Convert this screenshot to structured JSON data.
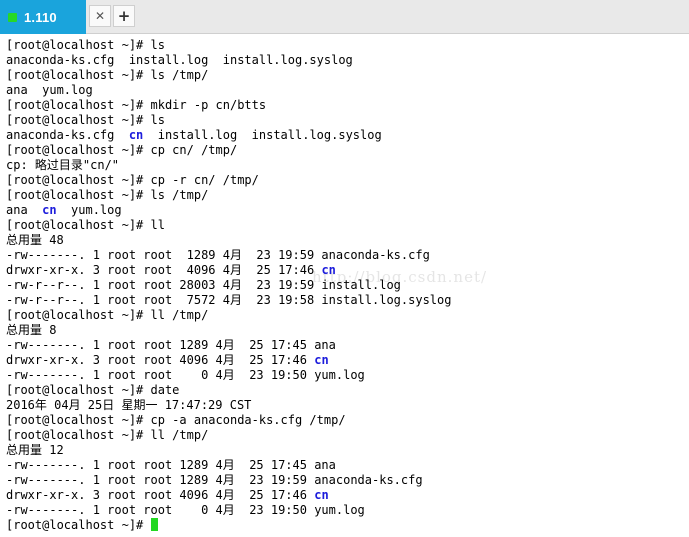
{
  "tab": {
    "label": "1.110",
    "close_glyph": "✕",
    "new_glyph": "+"
  },
  "watermark": "http://blog.csdn.net/",
  "terminal": {
    "lines": [
      [
        {
          "t": "[root@localhost ~]# ls"
        }
      ],
      [
        {
          "t": "anaconda-ks.cfg  install.log  install.log.syslog"
        }
      ],
      [
        {
          "t": "[root@localhost ~]# ls /tmp/"
        }
      ],
      [
        {
          "t": "ana  yum.log"
        }
      ],
      [
        {
          "t": "[root@localhost ~]# mkdir -p cn/btts"
        }
      ],
      [
        {
          "t": "[root@localhost ~]# ls"
        }
      ],
      [
        {
          "t": "anaconda-ks.cfg  "
        },
        {
          "t": "cn",
          "dir": true
        },
        {
          "t": "  install.log  install.log.syslog"
        }
      ],
      [
        {
          "t": "[root@localhost ~]# cp cn/ /tmp/"
        }
      ],
      [
        {
          "t": "cp: 略过目录\"cn/\""
        }
      ],
      [
        {
          "t": "[root@localhost ~]# cp -r cn/ /tmp/"
        }
      ],
      [
        {
          "t": "[root@localhost ~]# ls /tmp/"
        }
      ],
      [
        {
          "t": "ana  "
        },
        {
          "t": "cn",
          "dir": true
        },
        {
          "t": "  yum.log"
        }
      ],
      [
        {
          "t": "[root@localhost ~]# ll"
        }
      ],
      [
        {
          "t": "总用量 48"
        }
      ],
      [
        {
          "t": "-rw-------. 1 root root  1289 4月  23 19:59 anaconda-ks.cfg"
        }
      ],
      [
        {
          "t": "drwxr-xr-x. 3 root root  4096 4月  25 17:46 "
        },
        {
          "t": "cn",
          "dir": true
        }
      ],
      [
        {
          "t": "-rw-r--r--. 1 root root 28003 4月  23 19:59 install.log"
        }
      ],
      [
        {
          "t": "-rw-r--r--. 1 root root  7572 4月  23 19:58 install.log.syslog"
        }
      ],
      [
        {
          "t": "[root@localhost ~]# ll /tmp/"
        }
      ],
      [
        {
          "t": "总用量 8"
        }
      ],
      [
        {
          "t": "-rw-------. 1 root root 1289 4月  25 17:45 ana"
        }
      ],
      [
        {
          "t": "drwxr-xr-x. 3 root root 4096 4月  25 17:46 "
        },
        {
          "t": "cn",
          "dir": true
        }
      ],
      [
        {
          "t": "-rw-------. 1 root root    0 4月  23 19:50 yum.log"
        }
      ],
      [
        {
          "t": "[root@localhost ~]# date"
        }
      ],
      [
        {
          "t": "2016年 04月 25日 星期一 17:47:29 CST"
        }
      ],
      [
        {
          "t": "[root@localhost ~]# cp -a anaconda-ks.cfg /tmp/"
        }
      ],
      [
        {
          "t": "[root@localhost ~]# ll /tmp/"
        }
      ],
      [
        {
          "t": "总用量 12"
        }
      ],
      [
        {
          "t": "-rw-------. 1 root root 1289 4月  25 17:45 ana"
        }
      ],
      [
        {
          "t": "-rw-------. 1 root root 1289 4月  23 19:59 anaconda-ks.cfg"
        }
      ],
      [
        {
          "t": "drwxr-xr-x. 3 root root 4096 4月  25 17:46 "
        },
        {
          "t": "cn",
          "dir": true
        }
      ],
      [
        {
          "t": "-rw-------. 1 root root    0 4月  23 19:50 yum.log"
        }
      ],
      [
        {
          "t": "[root@localhost ~]# "
        }
      ]
    ]
  },
  "colors": {
    "tab_active": "#1aa4dc",
    "tab_dot": "#27d827",
    "directory": "#1d1ddc",
    "cursor": "#22d822"
  }
}
